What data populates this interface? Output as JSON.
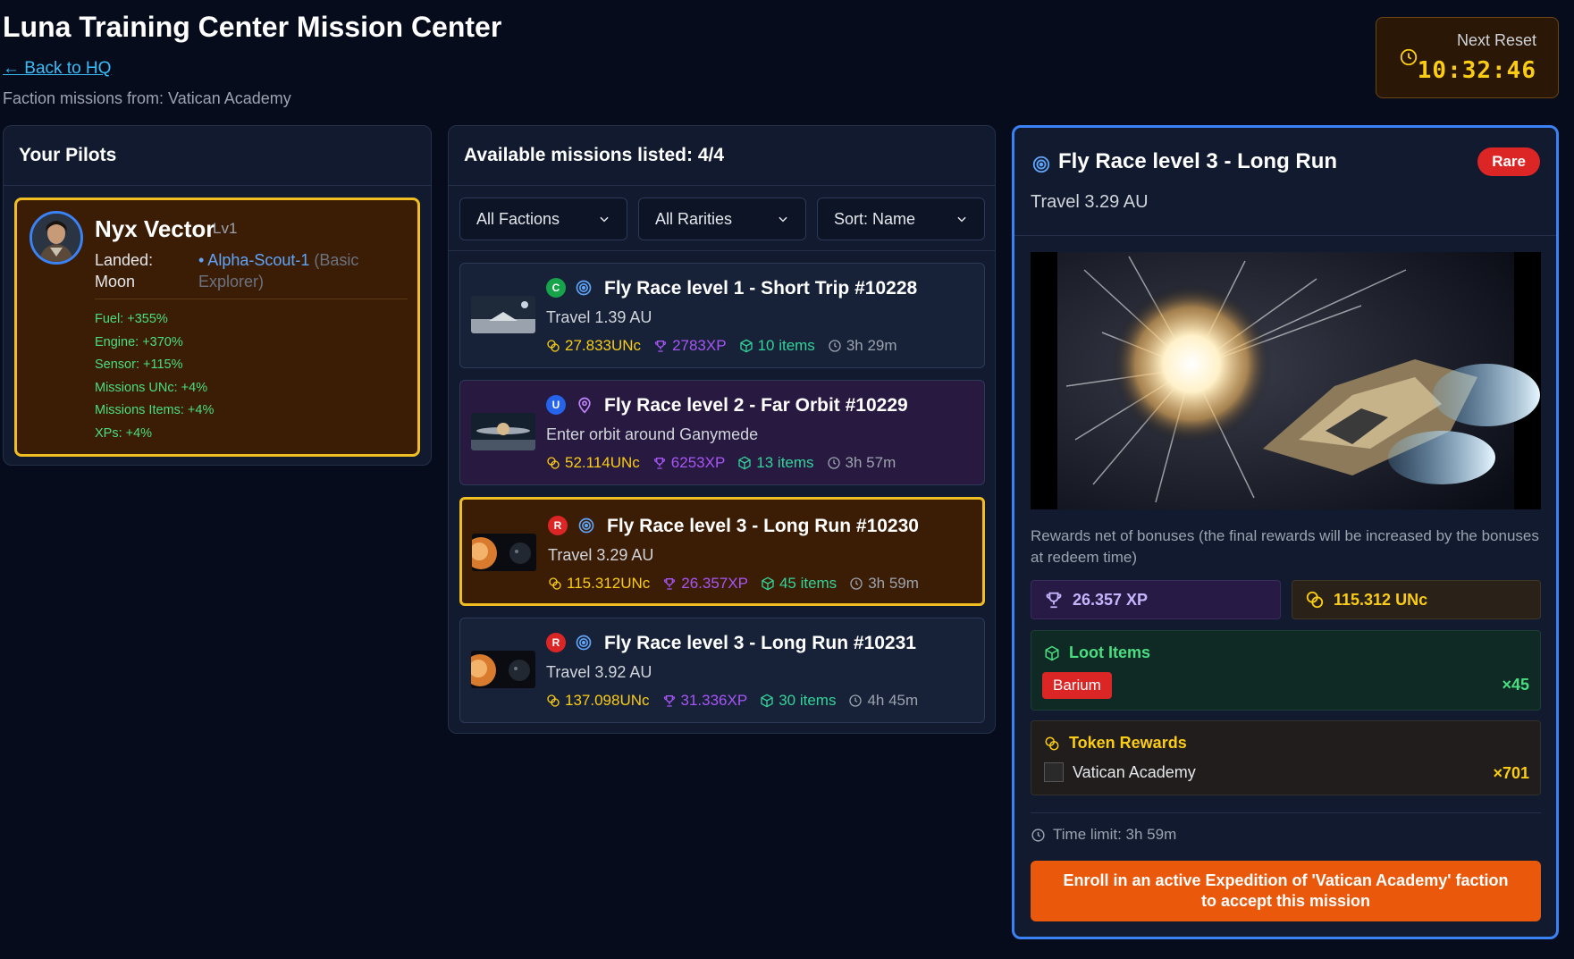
{
  "page": {
    "title": "Luna Training Center Mission Center",
    "back_link": "← Back to HQ",
    "faction_line": "Faction missions from: Vatican Academy"
  },
  "reset": {
    "label": "Next Reset",
    "time": "10:32:46"
  },
  "pilots": {
    "header": "Your Pilots",
    "pilot": {
      "name": "Nyx Vector",
      "level": "Lv1",
      "landed": "Landed: Moon",
      "ship_name": "• Alpha-Scout-1",
      "ship_type": "(Basic Explorer)",
      "stats": [
        "Fuel: +355%",
        "Engine: +370%",
        "Sensor: +115%",
        "Missions UNc: +4%",
        "Missions Items: +4%",
        "XPs: +4%"
      ]
    }
  },
  "missions": {
    "header": "Available missions listed: 4/4",
    "filters": {
      "faction": "All Factions",
      "rarity": "All Rarities",
      "sort": "Sort: Name"
    },
    "items": [
      {
        "rarity_letter": "C",
        "rarity_color": "#16a34a",
        "title": "Fly Race level 1 - Short Trip #10228",
        "subtitle": "Travel 1.39 AU",
        "unc": "27.833UNc",
        "xp": "2783XP",
        "items": "10 items",
        "time": "3h 29m"
      },
      {
        "rarity_letter": "U",
        "rarity_color": "#2563eb",
        "title": "Fly Race level 2 - Far Orbit #10229",
        "subtitle": "Enter orbit around Ganymede",
        "unc": "52.114UNc",
        "xp": "6253XP",
        "items": "13 items",
        "time": "3h 57m"
      },
      {
        "rarity_letter": "R",
        "rarity_color": "#dc2626",
        "title": "Fly Race level 3 - Long Run #10230",
        "subtitle": "Travel 3.29 AU",
        "unc": "115.312UNc",
        "xp": "26.357XP",
        "items": "45 items",
        "time": "3h 59m"
      },
      {
        "rarity_letter": "R",
        "rarity_color": "#dc2626",
        "title": "Fly Race level 3 - Long Run #10231",
        "subtitle": "Travel 3.92 AU",
        "unc": "137.098UNc",
        "xp": "31.336XP",
        "items": "30 items",
        "time": "4h 45m"
      }
    ]
  },
  "details": {
    "title": "Fly Race level 3 - Long Run",
    "rarity": "Rare",
    "subtitle": "Travel 3.29 AU",
    "note": "Rewards net of bonuses (the final rewards will be increased by the bonuses at redeem time)",
    "xp": "26.357 XP",
    "unc": "115.312 UNc",
    "loot_header": "Loot Items",
    "loot_item": "Barium",
    "loot_count": "×45",
    "token_header": "Token Rewards",
    "token_name": "Vatican Academy",
    "token_count": "×701",
    "time_limit": "Time limit: 3h 59m",
    "enroll": "Enroll in an active Expedition of 'Vatican Academy' faction to accept this mission"
  }
}
